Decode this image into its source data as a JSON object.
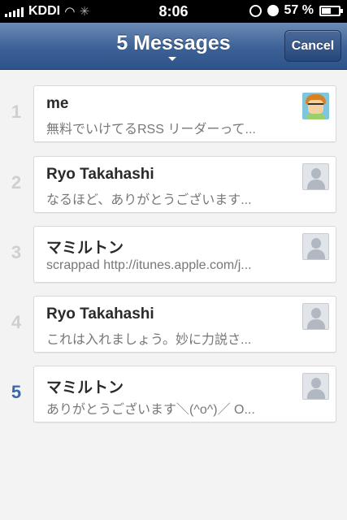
{
  "status_bar": {
    "carrier": "KDDI",
    "time": "8:06",
    "battery_percent": "57 %",
    "battery_level": 0.57
  },
  "nav": {
    "title": "5 Messages",
    "cancel_label": "Cancel"
  },
  "messages": [
    {
      "index": "1",
      "sender": "me",
      "preview": "無料でいけてるRSS リーダーって...",
      "avatar": "me-avatar-icon",
      "current": false
    },
    {
      "index": "2",
      "sender": "Ryo Takahashi",
      "preview": "なるほど、ありがとうございます...",
      "avatar": "placeholder-avatar-icon",
      "current": false
    },
    {
      "index": "3",
      "sender": "マミルトン",
      "preview": "scrappad http://itunes.apple.com/j...",
      "avatar": "placeholder-avatar-icon",
      "current": false
    },
    {
      "index": "4",
      "sender": "Ryo Takahashi",
      "preview": "これは入れましょう。妙に力説さ...",
      "avatar": "placeholder-avatar-icon",
      "current": false
    },
    {
      "index": "5",
      "sender": "マミルトン",
      "preview": "ありがとうございます＼(^o^)／ O...",
      "avatar": "placeholder-avatar-icon",
      "current": true
    }
  ],
  "colors": {
    "nav_bar": "#3c6196",
    "current_index": "#3b66a8",
    "inactive_index": "#cfcfcf"
  }
}
